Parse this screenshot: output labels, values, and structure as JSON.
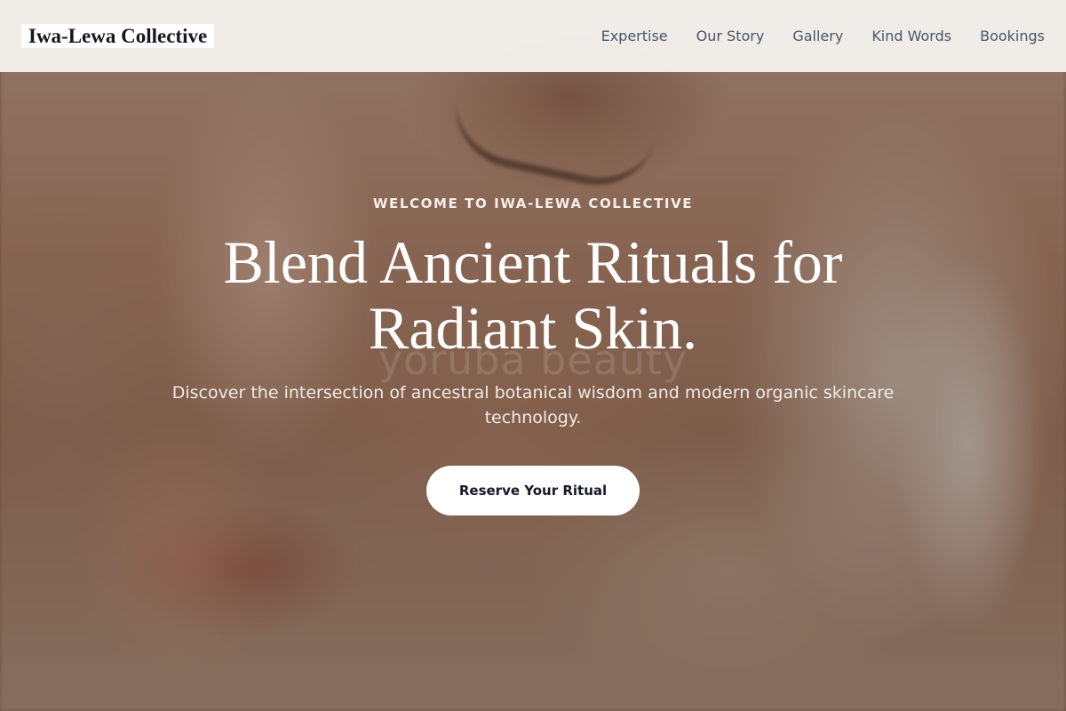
{
  "header": {
    "brand": "Iwa-Lewa Collective",
    "nav": [
      {
        "label": "Expertise"
      },
      {
        "label": "Our Story"
      },
      {
        "label": "Gallery"
      },
      {
        "label": "Kind Words"
      },
      {
        "label": "Bookings"
      }
    ]
  },
  "hero": {
    "eyebrow": "WELCOME TO IWA-LEWA COLLECTIVE",
    "headline": "Blend Ancient Rituals for Radiant Skin.",
    "subtext": "Discover the intersection of ancestral botanical wisdom and modern organic skincare technology.",
    "cta_label": "Reserve Your Ritual",
    "watermark": "yoruba beauty"
  },
  "colors": {
    "header_bg": "#f8f6f3",
    "nav_text": "#4a5566",
    "cta_bg": "#ffffff",
    "cta_text": "#141a26"
  }
}
